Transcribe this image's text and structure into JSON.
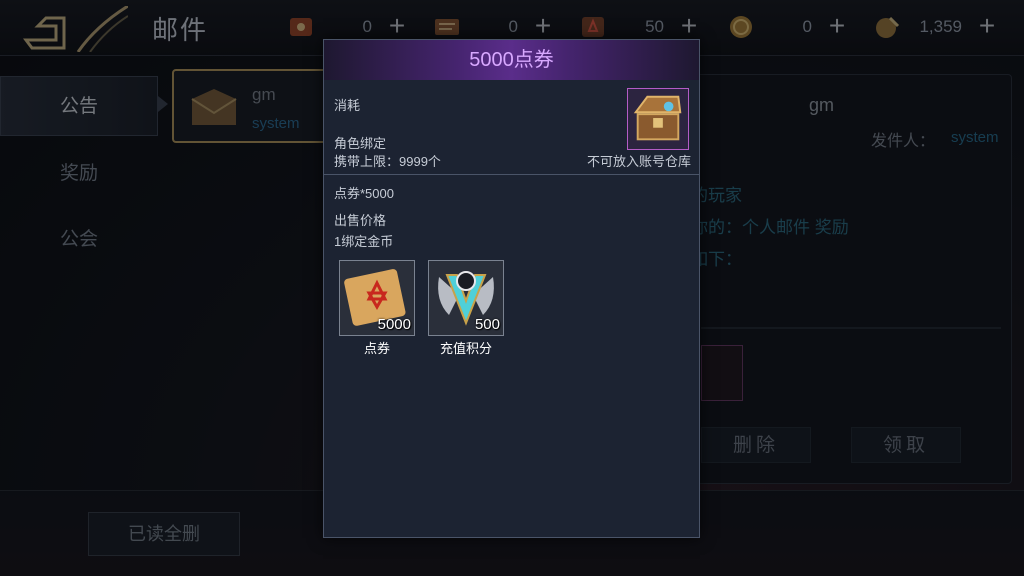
{
  "header": {
    "title": "邮件",
    "resources": [
      {
        "icon": "red-scroll-icon",
        "value": "0"
      },
      {
        "icon": "treasure-map-icon",
        "value": "0"
      },
      {
        "icon": "summon-scroll-icon",
        "value": "50"
      },
      {
        "icon": "gold-coin-icon",
        "value": "0"
      },
      {
        "icon": "bound-coin-icon",
        "value": "1,359"
      }
    ],
    "plus_label": "+"
  },
  "nav": {
    "items": [
      {
        "label": "公告"
      },
      {
        "label": "奖励"
      },
      {
        "label": "公会"
      }
    ]
  },
  "mail_list": {
    "item": {
      "sender": "gm",
      "sub": "system"
    }
  },
  "detail": {
    "sender_title": "gm",
    "from_label": "发件人：",
    "from_value": "system",
    "line1": "的玩家",
    "line2": "你的：个人邮件 奖励",
    "line3": "如下：",
    "delete_label": "删除",
    "claim_label": "领取"
  },
  "bottom": {
    "delete_all_label": "已读全删"
  },
  "popup": {
    "title": "5000点券",
    "type": "消耗",
    "bind": "角色绑定",
    "limit": "携带上限：9999个",
    "no_account_storage": "不可放入账号仓库",
    "desc": "点券*5000",
    "price_label": "出售价格",
    "price_value": "1绑定金币",
    "slots": [
      {
        "name": "点券",
        "count": "5000",
        "icon": "coupon-scroll-icon"
      },
      {
        "name": "充值积分",
        "count": "500",
        "icon": "recharge-points-emblem-icon"
      }
    ]
  },
  "colors": {
    "accent_purple": "#d8a8ff",
    "frame_gold": "#b39a62",
    "link_blue": "#2f6f9a"
  }
}
